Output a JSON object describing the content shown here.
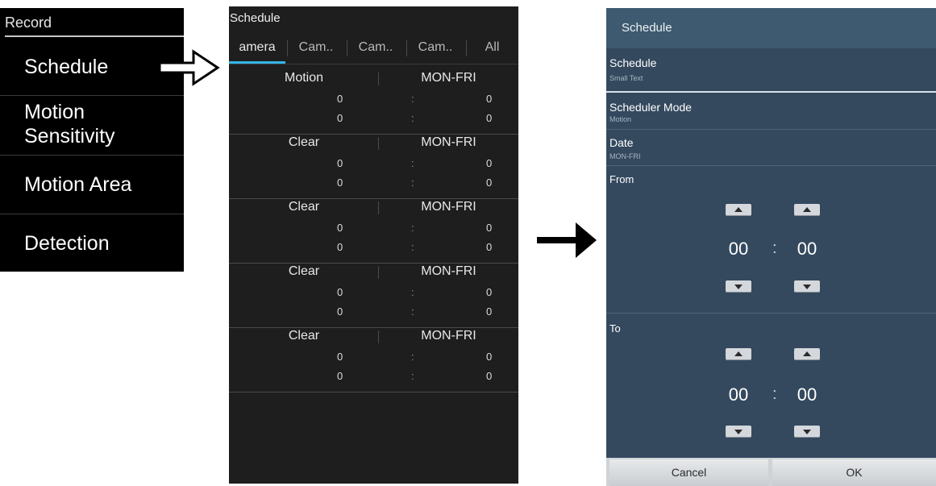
{
  "menu": {
    "title": "Record",
    "items": [
      "Schedule",
      "Motion",
      "Sensitivity",
      "Motion Area",
      "Detection"
    ]
  },
  "list": {
    "title": "Schedule",
    "tabs": [
      "amera",
      "Cam..",
      "Cam..",
      "Cam..",
      "All"
    ],
    "colon": ":",
    "groups": [
      {
        "mode": "Motion",
        "date": "MON-FRI",
        "rows": [
          [
            "0",
            "0"
          ],
          [
            "0",
            "0"
          ]
        ]
      },
      {
        "mode": "Clear",
        "date": "MON-FRI",
        "rows": [
          [
            "0",
            "0"
          ],
          [
            "0",
            "0"
          ]
        ]
      },
      {
        "mode": "Clear",
        "date": "MON-FRI",
        "rows": [
          [
            "0",
            "0"
          ],
          [
            "0",
            "0"
          ]
        ]
      },
      {
        "mode": "Clear",
        "date": "MON-FRI",
        "rows": [
          [
            "0",
            "0"
          ],
          [
            "0",
            "0"
          ]
        ]
      },
      {
        "mode": "Clear",
        "date": "MON-FRI",
        "rows": [
          [
            "0",
            "0"
          ],
          [
            "0",
            "0"
          ]
        ]
      }
    ]
  },
  "dialog": {
    "title": "Schedule",
    "schedule": {
      "title": "Schedule",
      "sub": "Small Text"
    },
    "mode": {
      "title": "Scheduler Mode",
      "sub": "Motion"
    },
    "date": {
      "title": "Date",
      "sub": "MON-FRI"
    },
    "from": {
      "label": "From",
      "hour": "00",
      "minute": "00"
    },
    "to": {
      "label": "To",
      "hour": "00",
      "minute": "00"
    },
    "colon": ":",
    "cancel": "Cancel",
    "ok": "OK"
  },
  "colors": {
    "accent_tab": "#33b5e5",
    "dialog_bg": "#34495e",
    "list_bg": "#1e1e1e"
  },
  "icons": [
    "outline-arrow-right-icon",
    "solid-arrow-right-icon",
    "spinner-up-icon",
    "spinner-down-icon"
  ]
}
